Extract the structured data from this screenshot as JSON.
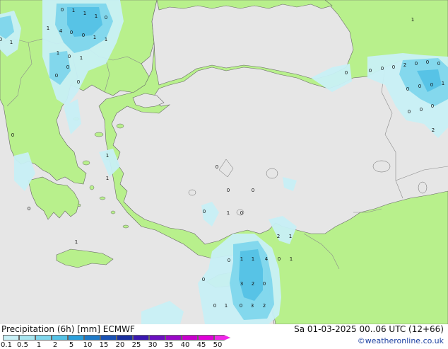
{
  "legend": {
    "title": "Precipitation (6h) [mm] ECMWF",
    "ticks": [
      "0.1",
      "0.5",
      "1",
      "2",
      "5",
      "10",
      "15",
      "20",
      "25",
      "30",
      "35",
      "40",
      "45",
      "50"
    ],
    "colors": [
      "#c8f0f6",
      "#a8e6f0",
      "#7fd6ec",
      "#54c2e6",
      "#2aa0dc",
      "#1e7ac8",
      "#1a52b4",
      "#1a30a0",
      "#3a18b0",
      "#6a10c0",
      "#9a08c8",
      "#c800cc",
      "#e000d8",
      "#f028e8"
    ]
  },
  "valid_time": "Sa 01-03-2025 00..06 UTC (12+66)",
  "credit": "©weatheronline.co.uk",
  "map": {
    "colors": {
      "sea": "#e6e6e6",
      "land": "#b8f08c",
      "border": "#8a8a8a",
      "coast": "#666666",
      "precip_light": "#c8f0f6",
      "precip_mid": "#7fd6ec",
      "precip_heavy": "#54c2e6"
    },
    "labels": [
      "0",
      "1",
      "1",
      "1",
      "0",
      "1",
      "4",
      "0",
      "0",
      "1",
      "1",
      "0",
      "1",
      "1",
      "0",
      "1",
      "0",
      "0",
      "0",
      "0",
      "1",
      "1",
      "0",
      "1",
      "0",
      "0",
      "0",
      "0",
      "1",
      "0",
      "1",
      "0",
      "0",
      "0",
      "0",
      "2",
      "0",
      "0",
      "0",
      "0",
      "0",
      "0",
      "1",
      "0",
      "0",
      "0",
      "2",
      "2",
      "1",
      "0",
      "1",
      "1",
      "4",
      "0",
      "1",
      "0",
      "3",
      "2",
      "0"
    ]
  }
}
